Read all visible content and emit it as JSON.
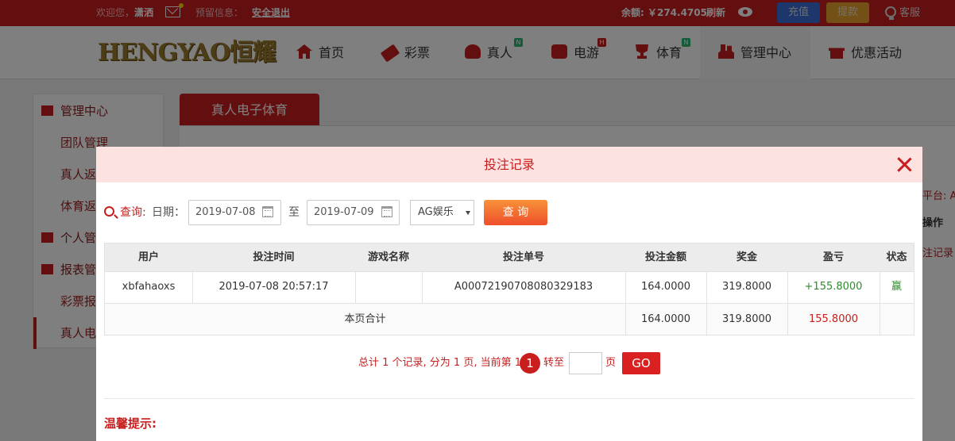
{
  "topbar": {
    "welcome_prefix": "欢迎您，",
    "username": "潇洒",
    "message_label": "预留信息：",
    "logout": "安全退出",
    "balance": "余额: ￥274.4705",
    "refresh": "刷新",
    "recharge": "充值",
    "withdraw": "提款",
    "service": "客服"
  },
  "logo": {
    "text": "HENGYAO恒耀"
  },
  "nav": {
    "items": [
      {
        "label": "首页",
        "icon": "home-icon",
        "badge": ""
      },
      {
        "label": "彩票",
        "icon": "ticket-icon",
        "badge": ""
      },
      {
        "label": "真人",
        "icon": "dealer-icon",
        "badge": "N"
      },
      {
        "label": "电游",
        "icon": "slot-machine-icon",
        "badge": "H"
      },
      {
        "label": "体育",
        "icon": "trophy-icon",
        "badge": "N"
      },
      {
        "label": "管理中心",
        "icon": "users-icon",
        "badge": ""
      },
      {
        "label": "优惠活动",
        "icon": "gift-icon",
        "badge": ""
      }
    ]
  },
  "sidebar": {
    "items": [
      {
        "label": "管理中心",
        "type": "group",
        "icon": "users-icon"
      },
      {
        "label": "团队管理",
        "type": "sub"
      },
      {
        "label": "真人返",
        "type": "sub"
      },
      {
        "label": "体育返",
        "type": "sub"
      },
      {
        "label": "个人管",
        "type": "group",
        "icon": "person-icon"
      },
      {
        "label": "报表管",
        "type": "group",
        "icon": "report-icon"
      },
      {
        "label": "彩票报",
        "type": "sub"
      },
      {
        "label": "真人电",
        "type": "sub",
        "active": true
      }
    ]
  },
  "content": {
    "tab_label": "真人电子体育",
    "peek_platform": "平台: AG",
    "peek_action_header": "操作",
    "peek_record_link": "注记录"
  },
  "modal": {
    "title": "投注记录",
    "query_label": "查询:",
    "date_label": "日期：",
    "date_from": "2019-07-08",
    "date_sep": "至",
    "date_to": "2019-07-09",
    "platform_selected": "AG娱乐",
    "query_button": "查 询",
    "columns": [
      "用户",
      "投注时间",
      "游戏名称",
      "投注单号",
      "投注金额",
      "奖金",
      "盈亏",
      "状态"
    ],
    "rows": [
      {
        "user": "xbfahaoxs",
        "time": "2019-07-08 20:57:17",
        "game": "",
        "order_no": "A0007219070808032918​3",
        "amount": "164.0000",
        "bonus": "319.8000",
        "profit": "+155.8000",
        "status": "赢"
      }
    ],
    "subtotal": {
      "label": "本页合计",
      "amount": "164.0000",
      "bonus": "319.8000",
      "profit": "155.8000"
    },
    "pager": {
      "summary": "总计 1 个记录, 分为 1 页, 当前第 1 页",
      "current_page": "1",
      "goto_label": "转至",
      "page_unit": "页",
      "go_button": "GO"
    },
    "tips_title": "温馨提示:"
  },
  "colors": {
    "brand_red": "#c81e1e",
    "profit_green": "#2e8b2e",
    "orange": "#f37a33",
    "modal_header": "#fde2e2"
  }
}
